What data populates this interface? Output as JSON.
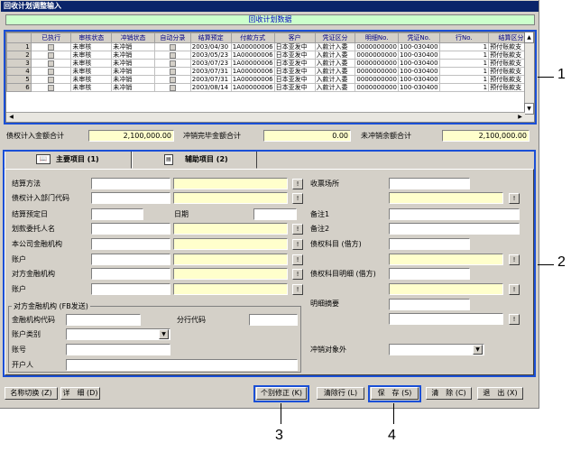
{
  "window": {
    "title": "回收计划调整输入"
  },
  "grid": {
    "caption": "回收计划数据",
    "columns": [
      "",
      "已执行",
      "审核状态",
      "冲销状态",
      "自动分录",
      "结算预定",
      "付款方式",
      "客户",
      "凭证区分",
      "明细No.",
      "凭证No.",
      "行No.",
      "结算区分"
    ],
    "rows": [
      [
        "1",
        "",
        "未审核",
        "未冲销",
        "",
        "2003/04/30",
        "1A00000006",
        "日本亚发中",
        "入款计入委",
        "0000000000",
        "100-030400",
        "1",
        "预付账款支"
      ],
      [
        "2",
        "",
        "未审核",
        "未冲销",
        "",
        "2003/05/23",
        "1A00000006",
        "日本亚发中",
        "入款计入委",
        "0000000000",
        "100-030400",
        "1",
        "预付账款支"
      ],
      [
        "3",
        "",
        "未审核",
        "未冲销",
        "",
        "2003/07/23",
        "1A00000006",
        "日本亚发中",
        "入款计入委",
        "0000000000",
        "100-030400",
        "1",
        "预付账款支"
      ],
      [
        "4",
        "",
        "未审核",
        "未冲销",
        "",
        "2003/07/31",
        "1A00000006",
        "日本亚发中",
        "入款计入委",
        "0000000000",
        "100-030400",
        "1",
        "预付账款支"
      ],
      [
        "5",
        "",
        "未审核",
        "未冲销",
        "",
        "2003/07/31",
        "1A00000006",
        "日本亚发中",
        "入款计入委",
        "0000000000",
        "100-030400",
        "1",
        "预付账款支"
      ],
      [
        "6",
        "",
        "未审核",
        "未冲销",
        "",
        "2003/08/14",
        "1A00000006",
        "日本亚发中",
        "入款计入委",
        "0000000000",
        "100-030400",
        "1",
        "预付账款支"
      ]
    ]
  },
  "totals": {
    "credit_label": "债权计入金额合计",
    "credit_value": "2,100,000.00",
    "offset_label": "冲销完毕金额合计",
    "offset_value": "0.00",
    "remaining_label": "未冲销余额合计",
    "remaining_value": "2,100,000.00"
  },
  "tabs": {
    "main": "主要项目 (1)",
    "aux": "辅助项目 (2)"
  },
  "form": {
    "settle_method": "结算方法",
    "credit_dept": "债权计入部门代码",
    "settle_date": "结算预定日",
    "date": "日期",
    "transfer_client": "划款委托人名",
    "own_bank": "本公司金融机构",
    "account1": "账户",
    "counter_bank": "对方金融机构",
    "account2": "账户",
    "counter_group": "对方金融机构 (FB发送)",
    "bank_code": "金融机构代码",
    "branch_code": "分行代码",
    "account_type": "账户类别",
    "account_no": "账号",
    "holder": "开户人",
    "receipt_place": "收票场所",
    "note1": "备注1",
    "note2": "备注2",
    "credit_subject": "债权科目 (借方)",
    "credit_subject_detail": "债权科目明细 (借方)",
    "detail_summary": "明细摘要",
    "offset_exclude": "冲销对象外"
  },
  "buttons": {
    "name_switch": "名称切换 (Z)",
    "detail": "详　细 (D)",
    "individual_fix": "个别修正 (K)",
    "clear_row": "清除行 (L)",
    "save": "保　存 (S)",
    "clear": "清　除 (C)",
    "exit": "退　出 (X)",
    "lookup": "!"
  },
  "callouts": [
    "1",
    "2",
    "3",
    "4"
  ],
  "colors": {
    "highlight": "#1a4fd6",
    "title": "#0a246a",
    "input_yellow": "#ffffcc"
  }
}
